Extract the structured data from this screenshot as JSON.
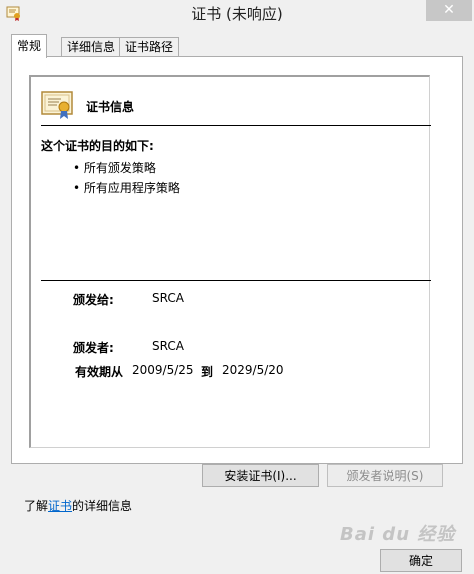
{
  "window": {
    "title": "证书 (未响应)",
    "close_glyph": "✕"
  },
  "tabs": [
    {
      "label": "常规",
      "active": true
    },
    {
      "label": "详细信息",
      "active": false
    },
    {
      "label": "证书路径",
      "active": false
    }
  ],
  "general": {
    "header": "证书信息",
    "purpose_title": "这个证书的目的如下:",
    "purposes": [
      "所有颁发策略",
      "所有应用程序策略"
    ],
    "issued_to_label": "颁发给:",
    "issued_to_value": "SRCA",
    "issued_by_label": "颁发者:",
    "issued_by_value": "SRCA",
    "validity_label": "有效期从",
    "valid_from": "2009/5/25",
    "to_label": "到",
    "valid_to": "2029/5/20"
  },
  "buttons": {
    "install": "安装证书(I)...",
    "issuer_statement": "颁发者说明(S)",
    "ok": "确定"
  },
  "footer": {
    "learn_prefix": "了解",
    "learn_link": "证书",
    "learn_suffix": "的详细信息"
  },
  "watermark": "Bai du 经验",
  "colors": {
    "link": "#0066cc",
    "dialog_bg": "#f0f0f0"
  },
  "icons": {
    "app": "certificate-icon",
    "cert": "certificate-ribbon-icon",
    "close": "close-icon"
  }
}
